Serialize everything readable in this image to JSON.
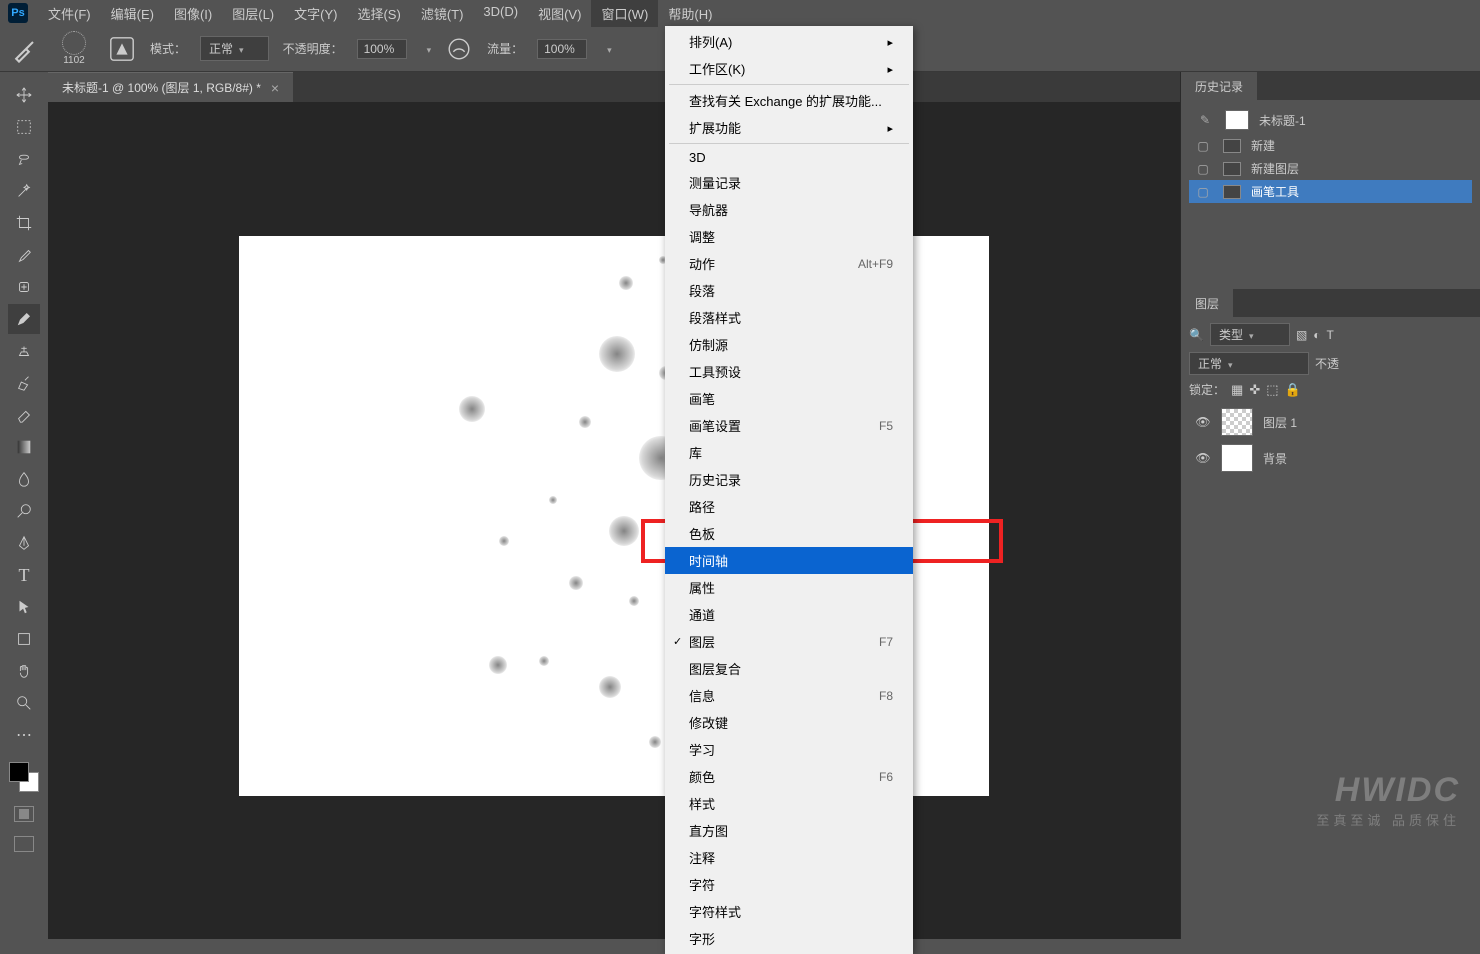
{
  "menubar": [
    "文件(F)",
    "编辑(E)",
    "图像(I)",
    "图层(L)",
    "文字(Y)",
    "选择(S)",
    "滤镜(T)",
    "3D(D)",
    "视图(V)",
    "窗口(W)",
    "帮助(H)"
  ],
  "menubar_open_index": 9,
  "options": {
    "brush_size": "1102",
    "mode_label": "模式：",
    "mode_value": "正常",
    "opacity_label": "不透明度：",
    "opacity_value": "100%",
    "flow_label": "流量：",
    "flow_value": "100%"
  },
  "document": {
    "tab_title": "未标题-1 @ 100% (图层 1, RGB/8#) *"
  },
  "dropdown": {
    "sections": [
      [
        {
          "label": "排列(A)",
          "arrow": true
        },
        {
          "label": "工作区(K)",
          "arrow": true
        }
      ],
      [
        {
          "label": "查找有关 Exchange 的扩展功能..."
        },
        {
          "label": "扩展功能",
          "arrow": true
        }
      ],
      [
        {
          "label": "3D"
        },
        {
          "label": "测量记录"
        },
        {
          "label": "导航器"
        },
        {
          "label": "调整"
        },
        {
          "label": "动作",
          "shortcut": "Alt+F9"
        },
        {
          "label": "段落"
        },
        {
          "label": "段落样式"
        },
        {
          "label": "仿制源"
        },
        {
          "label": "工具预设"
        },
        {
          "label": "画笔"
        },
        {
          "label": "画笔设置",
          "shortcut": "F5"
        },
        {
          "label": "库"
        },
        {
          "label": "历史记录"
        },
        {
          "label": "路径"
        },
        {
          "label": "色板"
        },
        {
          "label": "时间轴",
          "highlight": true
        },
        {
          "label": "属性"
        },
        {
          "label": "通道"
        },
        {
          "label": "图层",
          "shortcut": "F7",
          "check": true
        },
        {
          "label": "图层复合"
        },
        {
          "label": "信息",
          "shortcut": "F8"
        },
        {
          "label": "修改键"
        },
        {
          "label": "学习"
        },
        {
          "label": "颜色",
          "shortcut": "F6"
        },
        {
          "label": "样式"
        },
        {
          "label": "直方图"
        },
        {
          "label": "注释"
        },
        {
          "label": "字符"
        },
        {
          "label": "字符样式"
        },
        {
          "label": "字形"
        }
      ]
    ]
  },
  "history_panel": {
    "tab": "历史记录",
    "doc_name": "未标题-1",
    "steps": [
      "新建",
      "新建图层",
      "画笔工具"
    ],
    "active_step_index": 2
  },
  "layers_panel": {
    "tab": "图层",
    "type_label": "类型",
    "blend_mode": "正常",
    "opacity_label": "不透",
    "lock_label": "锁定：",
    "layers": [
      {
        "name": "图层 1",
        "checker": true
      },
      {
        "name": "背景",
        "checker": false
      }
    ]
  },
  "watermark": {
    "big": "HWIDC",
    "small": "至真至诚 品质保住"
  }
}
